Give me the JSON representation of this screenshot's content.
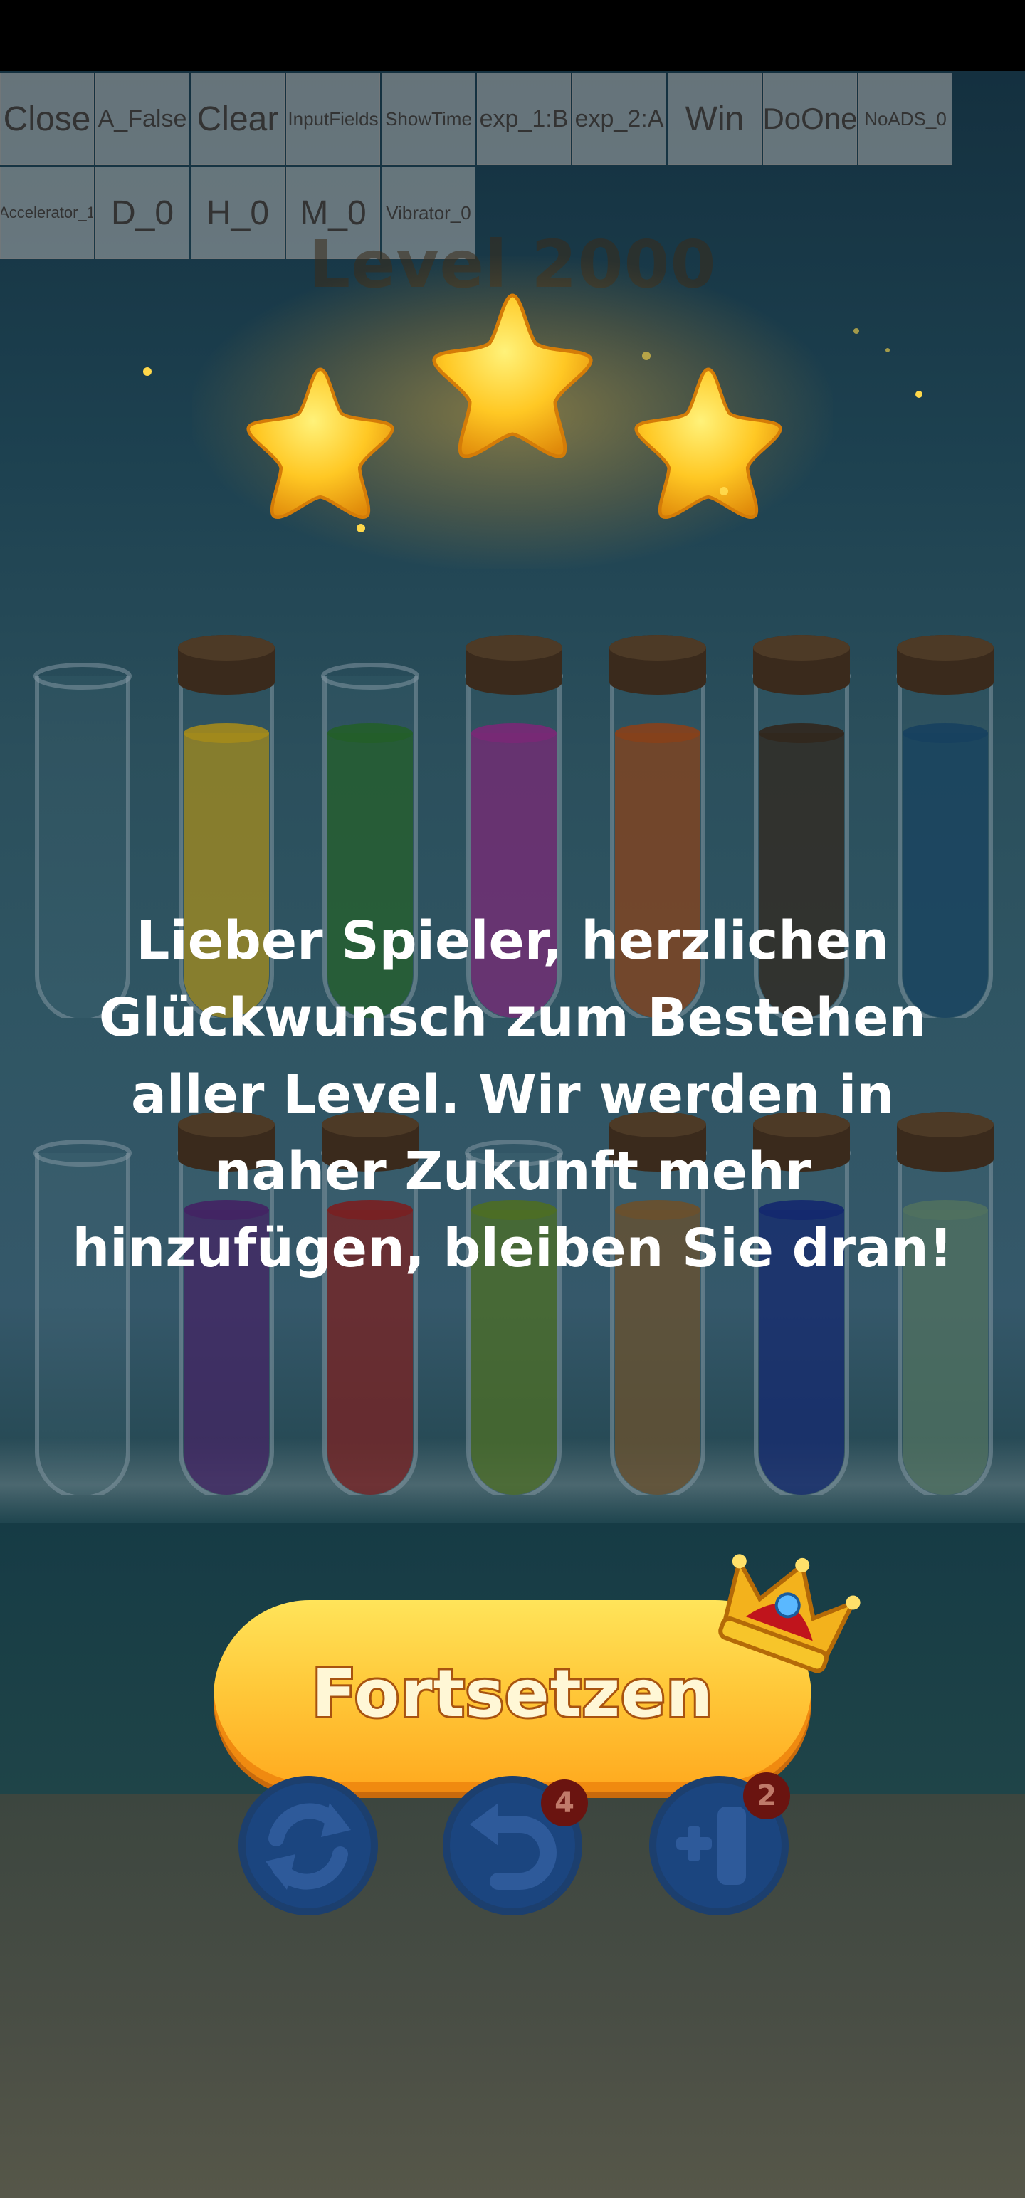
{
  "debug_toolbar": {
    "row1": [
      "Close",
      "A_False",
      "Clear",
      "InputFields",
      "ShowTime",
      "exp_1:B",
      "exp_2:A",
      "Win",
      "DoOne",
      "NoADS_0"
    ],
    "row2": [
      "Accelerator_1",
      "D_0",
      "H_0",
      "M_0",
      "Vibrator_0"
    ]
  },
  "level": {
    "title": "Level 2000",
    "stars_earned": 3,
    "stars_total": 3
  },
  "tubes": {
    "top_row": [
      {
        "liquid": "",
        "corked": false
      },
      {
        "liquid": "#a88a10",
        "corked": true
      },
      {
        "liquid": "#1d5a1f",
        "corked": false
      },
      {
        "liquid": "#7a1f72",
        "corked": true
      },
      {
        "liquid": "#8a3a0e",
        "corked": true
      },
      {
        "liquid": "#2c1e12",
        "corked": true
      },
      {
        "liquid": "#0f3a5a",
        "corked": true
      }
    ],
    "bottom_row": [
      {
        "liquid": "",
        "corked": false
      },
      {
        "liquid": "#3f1a5e",
        "corked": true
      },
      {
        "liquid": "#7a1616",
        "corked": true
      },
      {
        "liquid": "#4a6a1a",
        "corked": false
      },
      {
        "liquid": "#6a4a22",
        "corked": true
      },
      {
        "liquid": "#0c1f6a",
        "corked": true
      },
      {
        "liquid": "#4d6e5a",
        "corked": true
      }
    ]
  },
  "dialog": {
    "message": "Lieber Spieler, herzlichen Glückwunsch zum Bestehen aller Level. Wir werden in naher Zukunft mehr hinzufügen, bleiben Sie dran!",
    "continue_label": "Fortsetzen"
  },
  "toolbar": {
    "restart": {
      "icon": "restart-icon"
    },
    "undo": {
      "icon": "undo-icon",
      "badge": "4"
    },
    "add_tube": {
      "icon": "add-tube-icon",
      "badge": "2"
    }
  },
  "colors": {
    "accent": "#ffc93a",
    "button_shadow": "#c96a0c",
    "tool_blue": "#1c4a8a",
    "badge_red": "#b01a12"
  }
}
